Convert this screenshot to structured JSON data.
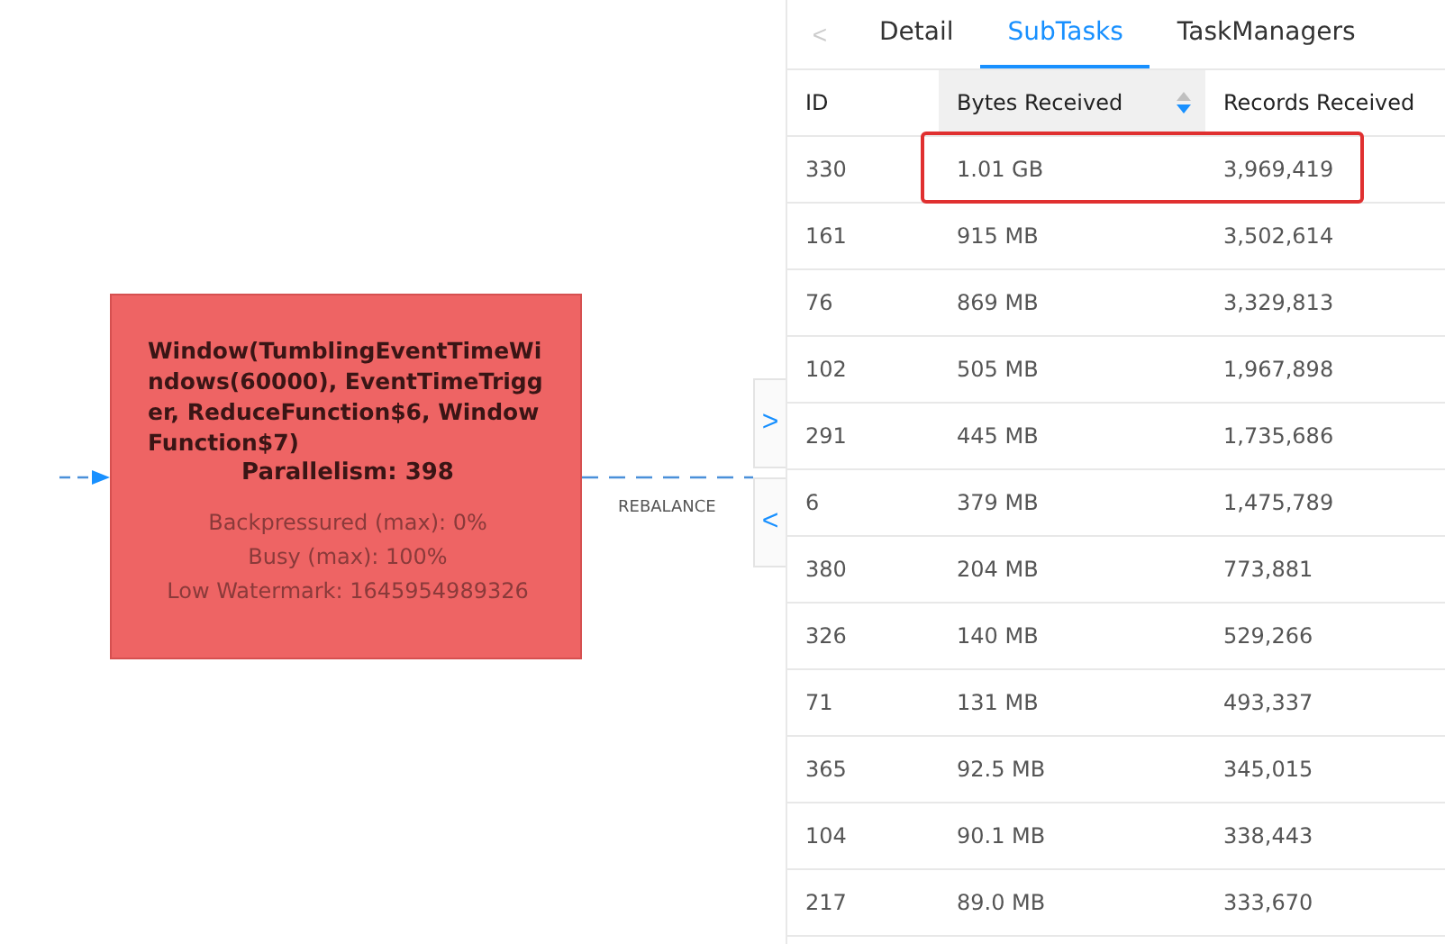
{
  "graph": {
    "node": {
      "title": "Window(TumblingEventTimeWindows(60000), EventTimeTrigger, ReduceFunction$6, WindowFunction$7)",
      "parallelism": "Parallelism: 398",
      "metrics": [
        "Backpressured (max): 0%",
        "Busy (max): 100%",
        "Low Watermark: 1645954989326"
      ]
    },
    "edge_label": "REBALANCE",
    "toggles": [
      ">",
      "<"
    ]
  },
  "panel": {
    "tab_scroll": "<",
    "tabs": [
      {
        "label": "Detail",
        "selected": false
      },
      {
        "label": "SubTasks",
        "selected": true
      },
      {
        "label": "TaskManagers",
        "selected": false
      }
    ],
    "table": {
      "columns": [
        {
          "label": "ID",
          "sorted": false
        },
        {
          "label": "Bytes Received",
          "sorted": true,
          "descending": true
        },
        {
          "label": "Records Received",
          "sorted": false
        }
      ],
      "rows": [
        {
          "cells": [
            "330",
            "1.01 GB",
            "3,969,419"
          ],
          "highlighted": true
        },
        {
          "cells": [
            "161",
            "915 MB",
            "3,502,614"
          ],
          "highlighted": false
        },
        {
          "cells": [
            "76",
            "869 MB",
            "3,329,813"
          ],
          "highlighted": false
        },
        {
          "cells": [
            "102",
            "505 MB",
            "1,967,898"
          ],
          "highlighted": false
        },
        {
          "cells": [
            "291",
            "445 MB",
            "1,735,686"
          ],
          "highlighted": false
        },
        {
          "cells": [
            "6",
            "379 MB",
            "1,475,789"
          ],
          "highlighted": false
        },
        {
          "cells": [
            "380",
            "204 MB",
            "773,881"
          ],
          "highlighted": false
        },
        {
          "cells": [
            "326",
            "140 MB",
            "529,266"
          ],
          "highlighted": false
        },
        {
          "cells": [
            "71",
            "131 MB",
            "493,337"
          ],
          "highlighted": false
        },
        {
          "cells": [
            "365",
            "92.5 MB",
            "345,015"
          ],
          "highlighted": false
        },
        {
          "cells": [
            "104",
            "90.1 MB",
            "338,443"
          ],
          "highlighted": false
        },
        {
          "cells": [
            "217",
            "89.0 MB",
            "333,670"
          ],
          "highlighted": false
        }
      ]
    }
  }
}
